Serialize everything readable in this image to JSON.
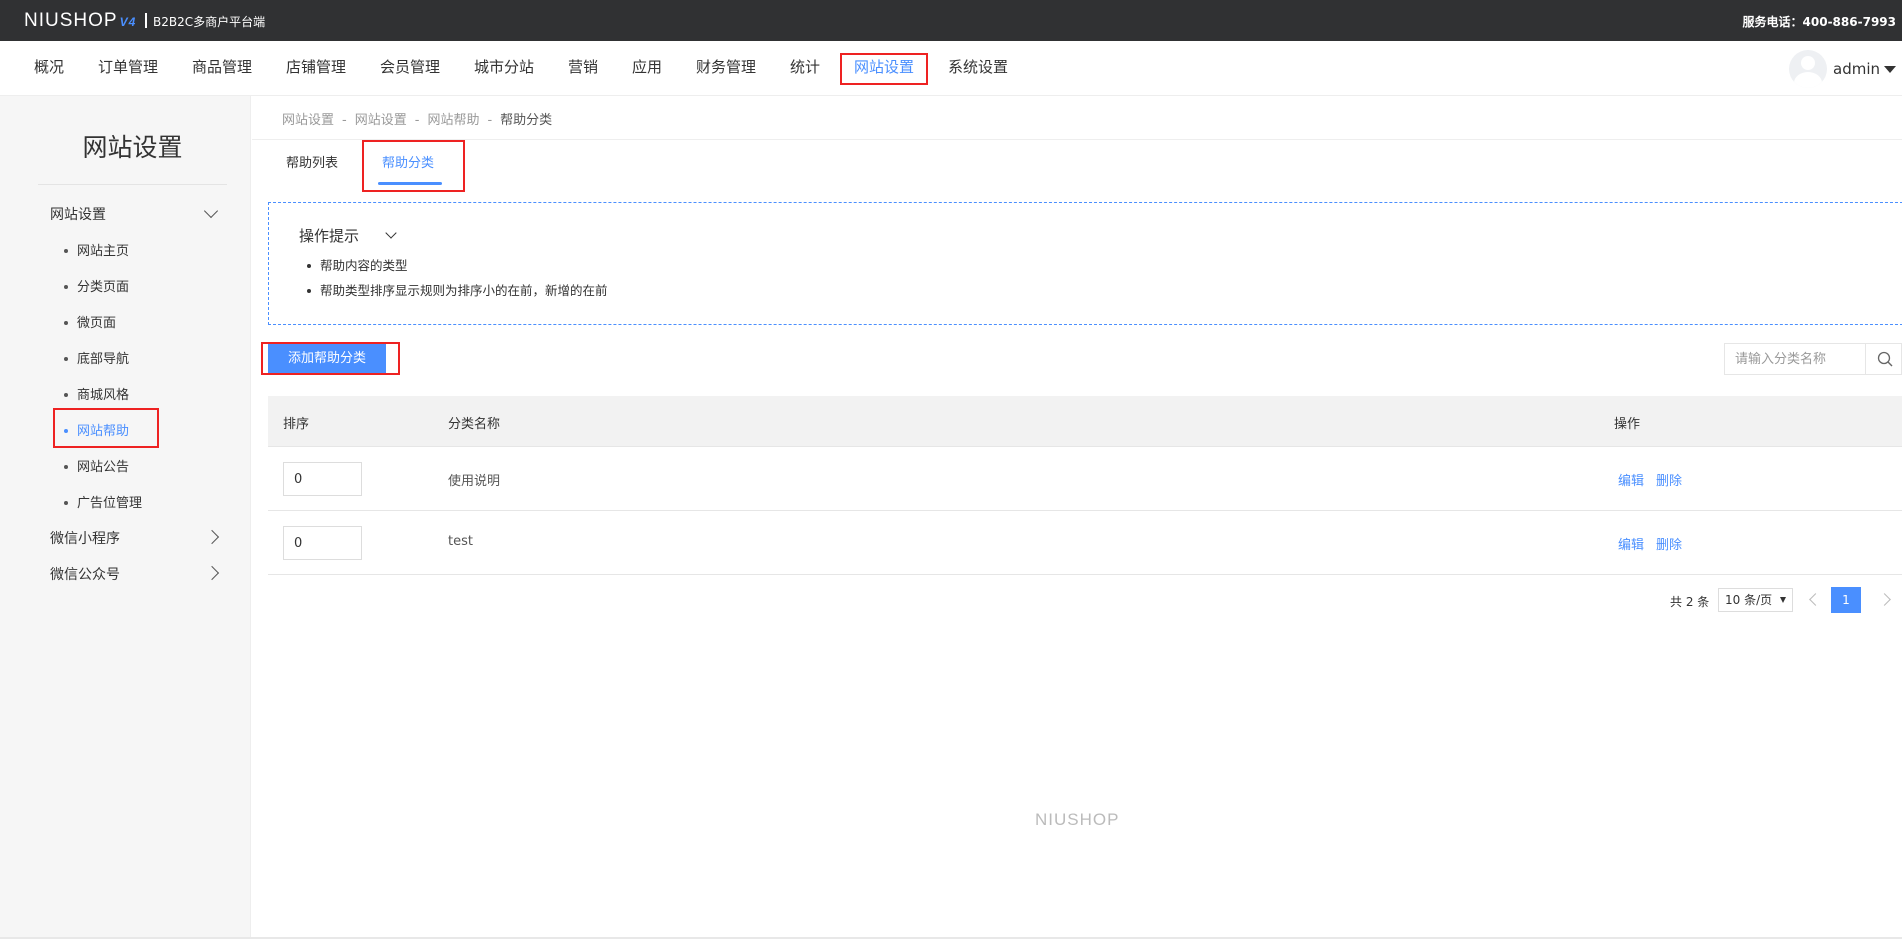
{
  "header": {
    "logo_text": "NIUSHOP",
    "logo_version": "V4",
    "subtitle": "B2B2C多商户平台端",
    "phone": "服务电话：400-886-7993"
  },
  "nav": {
    "items": [
      "概况",
      "订单管理",
      "商品管理",
      "店铺管理",
      "会员管理",
      "城市分站",
      "营销",
      "应用",
      "财务管理",
      "统计",
      "网站设置",
      "系统设置"
    ],
    "active": "网站设置"
  },
  "user": {
    "name": "admin"
  },
  "sidebar": {
    "title": "网站设置",
    "groups": [
      {
        "label": "网站设置",
        "expanded": true,
        "items": [
          "网站主页",
          "分类页面",
          "微页面",
          "底部导航",
          "商城风格",
          "网站帮助",
          "网站公告",
          "广告位管理"
        ],
        "active": "网站帮助"
      },
      {
        "label": "微信小程序",
        "expanded": false
      },
      {
        "label": "微信公众号",
        "expanded": false
      }
    ]
  },
  "breadcrumb": [
    "网站设置",
    "网站设置",
    "网站帮助",
    "帮助分类"
  ],
  "tabs": {
    "items": [
      "帮助列表",
      "帮助分类"
    ],
    "active": "帮助分类"
  },
  "tips": {
    "title": "操作提示",
    "items": [
      "帮助内容的类型",
      "帮助类型排序显示规则为排序小的在前，新增的在前"
    ]
  },
  "toolbar": {
    "add_label": "添加帮助分类",
    "search_placeholder": "请输入分类名称"
  },
  "table": {
    "columns": [
      "排序",
      "分类名称",
      "操作"
    ],
    "rows": [
      {
        "sort": "0",
        "name": "使用说明",
        "edit": "编辑",
        "delete": "删除"
      },
      {
        "sort": "0",
        "name": "test",
        "edit": "编辑",
        "delete": "删除"
      }
    ]
  },
  "pagination": {
    "total": "共 2 条",
    "page_size": "10 条/页",
    "current": "1"
  },
  "footer": {
    "logo": "NIUSHOP"
  },
  "colors": {
    "accent": "#4a8fff",
    "topbar": "#303133",
    "highlight_box": "#ee2222"
  }
}
